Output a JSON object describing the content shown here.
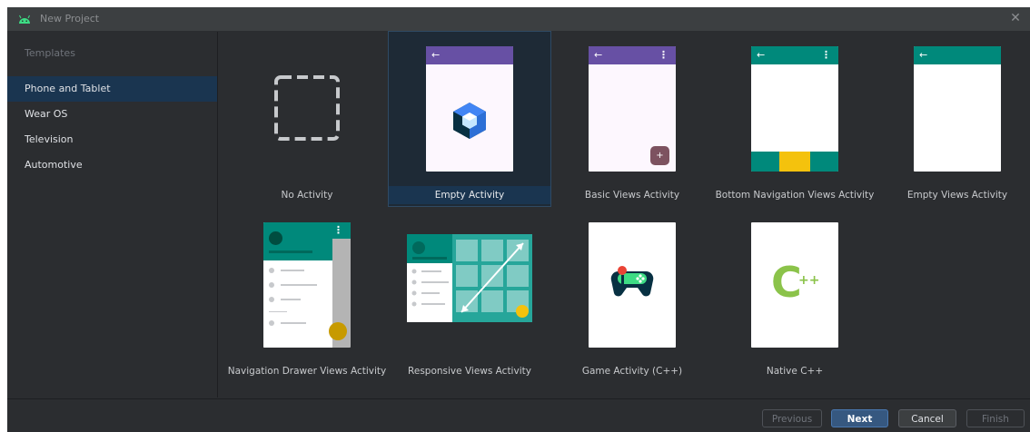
{
  "window": {
    "title": "New Project"
  },
  "sidebar": {
    "heading": "Templates",
    "items": [
      {
        "label": "Phone and Tablet",
        "selected": true
      },
      {
        "label": "Wear OS",
        "selected": false
      },
      {
        "label": "Television",
        "selected": false
      },
      {
        "label": "Automotive",
        "selected": false
      }
    ]
  },
  "templates": [
    {
      "label": "No Activity",
      "selected": false
    },
    {
      "label": "Empty Activity",
      "selected": true
    },
    {
      "label": "Basic Views Activity",
      "selected": false
    },
    {
      "label": "Bottom Navigation Views Activity",
      "selected": false
    },
    {
      "label": "Empty Views Activity",
      "selected": false
    },
    {
      "label": "Navigation Drawer Views Activity",
      "selected": false
    },
    {
      "label": "Responsive Views Activity",
      "selected": false
    },
    {
      "label": "Game Activity (C++)",
      "selected": false
    },
    {
      "label": "Native C++",
      "selected": false
    }
  ],
  "preview_text": {
    "cpp": "C",
    "plus": "++",
    "fab": "+",
    "arrow": "←",
    "kebab": "⋮"
  },
  "footer": {
    "previous": "Previous",
    "next": "Next",
    "cancel": "Cancel",
    "finish": "Finish"
  },
  "colors": {
    "purple_bar": "#6750a4",
    "teal_bar": "#00897b",
    "accent_blue": "#365880",
    "yellow": "#f4c20d",
    "android_green": "#3ddc84"
  }
}
